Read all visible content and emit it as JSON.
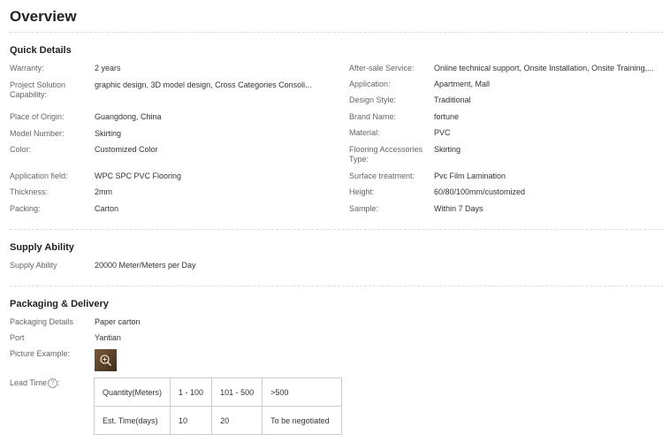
{
  "overview": {
    "title": "Overview"
  },
  "quick_details": {
    "heading": "Quick Details",
    "left": [
      {
        "label": "Warranty:",
        "value": "2 years"
      },
      {
        "label": "Project Solution Capability:",
        "value": "graphic design, 3D model design, Cross Categories Consoli..."
      },
      {
        "label": "Place of Origin:",
        "value": "Guangdong, China"
      },
      {
        "label": "Model Number:",
        "value": "Skirting"
      },
      {
        "label": "Color:",
        "value": "Customized Color"
      },
      {
        "label": "Application field:",
        "value": "WPC SPC PVC Flooring"
      },
      {
        "label": "Thickness:",
        "value": "2mm"
      },
      {
        "label": "Packing:",
        "value": "Carton"
      }
    ],
    "right": [
      {
        "label": "After-sale Service:",
        "value": "Online technical support, Onsite Installation, Onsite Training,..."
      },
      {
        "label": "Application:",
        "value": "Apartment, Mall"
      },
      {
        "label": "Design Style:",
        "value": "Traditional"
      },
      {
        "label": "Brand Name:",
        "value": "fortune"
      },
      {
        "label": "Material:",
        "value": "PVC"
      },
      {
        "label": "Flooring Accessories Type:",
        "value": "Skirting"
      },
      {
        "label": "Surface treatment:",
        "value": "Pvc Film Lamination"
      },
      {
        "label": "Height:",
        "value": "60/80/100mm/customized"
      },
      {
        "label": "Sample:",
        "value": "Within 7 Days"
      }
    ]
  },
  "supply_ability": {
    "heading": "Supply Ability",
    "label": "Supply Ability",
    "value": "20000 Meter/Meters per Day"
  },
  "packaging": {
    "heading": "Packaging & Delivery",
    "details_label": "Packaging Details",
    "details_value": "Paper carton",
    "port_label": "Port",
    "port_value": "Yantian",
    "picture_label": "Picture Example:",
    "lead_time_label": "Lead Time",
    "help_glyph": "?",
    "lead_table": {
      "header": [
        "Quantity(Meters)",
        "1 - 100",
        "101 - 500",
        ">500"
      ],
      "row": [
        "Est. Time(days)",
        "10",
        "20",
        "To be negotiated"
      ]
    }
  },
  "icons": {
    "zoom": "zoom-icon",
    "help": "help-icon"
  }
}
